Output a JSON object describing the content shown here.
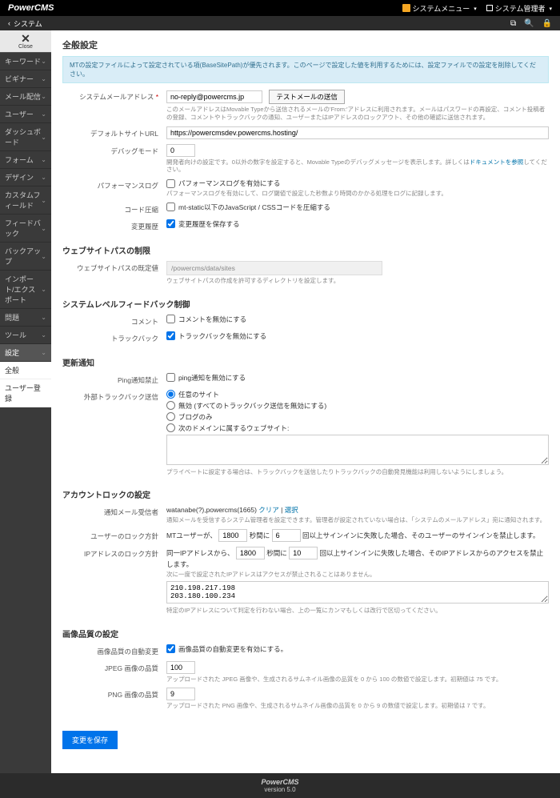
{
  "topbar": {
    "brand": "PowerCMS",
    "menu1": "システムメニュー",
    "menu2": "システム管理者"
  },
  "subbar": {
    "title": "システム"
  },
  "sidebar": {
    "close": "Close",
    "items": [
      "キーワード",
      "ビギナー",
      "メール配信",
      "ユーザー",
      "ダッシュボード",
      "フォーム",
      "デザイン",
      "カスタムフィールド",
      "フィードバック",
      "バックアップ",
      "インポート/エクスポート",
      "問題",
      "ツール",
      "設定"
    ],
    "sub": [
      "全般",
      "ユーザー登録"
    ]
  },
  "page": {
    "title": "全般設定",
    "info": "MTの設定ファイルによって設定されている項(BaseSitePath)が優先されます。このページで設定した値を利用するためには、設定ファイルでの設定を削除してください。"
  },
  "email": {
    "label": "システムメールアドレス",
    "value": "no-reply@powercms.jp",
    "btn": "テストメールの送信",
    "hint": "このメールアドレスはMovable Typeから送信されるメールの'From:'アドレスに利用されます。メールはパスワードの再設定、コメント投稿者の登録、コメントやトラックバックの通知、ユーザーまたはIPアドレスのロックアウト、その他の確認に送信されます。"
  },
  "siteurl": {
    "label": "デフォルトサイトURL",
    "value": "https://powercmsdev.powercms.hosting/"
  },
  "debug": {
    "label": "デバッグモード",
    "value": "0",
    "hint_a": "開発者向けの設定です。0以外の数字を設定すると、Movable Typeのデバッグメッセージを表示します。詳しくは",
    "hint_link": "ドキュメントを参照",
    "hint_b": "してください。"
  },
  "perflog": {
    "label": "パフォーマンスログ",
    "cb": "パフォーマンスログを有効にする",
    "hint": "パフォーマンスログを有効にして、ログ閾値で設定した秒数より時間のかかる処理をログに記録します。"
  },
  "minify": {
    "label": "コード圧縮",
    "cb": "mt-static以下のJavaScript / CSSコードを圧縮する"
  },
  "history": {
    "label": "変更履歴",
    "cb": "変更履歴を保存する"
  },
  "wspath": {
    "title": "ウェブサイトパスの制限",
    "label": "ウェブサイトパスの既定値",
    "value": "/powercms/data/sites",
    "hint": "ウェブサイトパスの作成を許可するディレクトリを設定します。"
  },
  "feedback": {
    "title": "システムレベルフィードバック制御",
    "comment_label": "コメント",
    "comment_cb": "コメントを無効にする",
    "tb_label": "トラックバック",
    "tb_cb": "トラックバックを無効にする"
  },
  "update": {
    "title": "更新通知",
    "ping_label": "Ping通知禁止",
    "ping_cb": "ping通知を無効にする",
    "ext_label": "外部トラックバック送信",
    "r1": "任意のサイト",
    "r2": "無効 (すべてのトラックバック送信を無効にする)",
    "r3": "ブログのみ",
    "r4": "次のドメインに属するウェブサイト:",
    "hint": "プライベートに設定する場合は、トラックバックを送信したりトラックバックの自動発見機能は利用しないようにしましょう。"
  },
  "lock": {
    "title": "アカウントロックの設定",
    "notify_label": "通知メール受信者",
    "notify_val": "watanabe(?),powercms(1665)",
    "clear": "クリア",
    "select": "選択",
    "notify_hint": "通知メールを受信するシステム管理者を設定できます。管理者が設定されていない場合は、「システムのメールアドレス」宛に通知されます。",
    "user_label": "ユーザーのロック方針",
    "user_a": "MTユーザーが、",
    "user_v1": "1800",
    "user_b": "秒間に",
    "user_v2": "6",
    "user_c": "回以上サインインに失敗した場合、そのユーザーのサインインを禁止します。",
    "ip_label": "IPアドレスのロック方針",
    "ip_a": "同一IPアドレスから、",
    "ip_v1": "1800",
    "ip_b": "秒間に",
    "ip_v2": "10",
    "ip_c": "回以上サインインに失敗した場合、そのIPアドレスからのアクセスを禁止します。",
    "ip_hint": "次に一度で設定されたIPアドレスはアクセスが禁止されることはありません。",
    "ip_list": "210.198.217.198\n203.180.100.234",
    "ip_hint2": "特定のIPアドレスについて判定を行わない場合、上の一覧にカンマもしくは改行で区切ってください。"
  },
  "img": {
    "title": "画像品質の設定",
    "auto_label": "画像品質の自動変更",
    "auto_cb": "画像品質の自動変更を有効にする。",
    "jpeg_label": "JPEG 画像の品質",
    "jpeg_val": "100",
    "jpeg_hint": "アップロードされた JPEG 画像や、生成されるサムネイル画像の品質を 0 から 100 の数値で設定します。初期値は 75 です。",
    "png_label": "PNG 画像の品質",
    "png_val": "9",
    "png_hint": "アップロードされた PNG 画像や、生成されるサムネイル画像の品質を 0 から 9 の数値で設定します。初期値は 7 です。"
  },
  "save": "変更を保存",
  "footer": {
    "brand": "PowerCMS",
    "ver": "version 5.0"
  }
}
